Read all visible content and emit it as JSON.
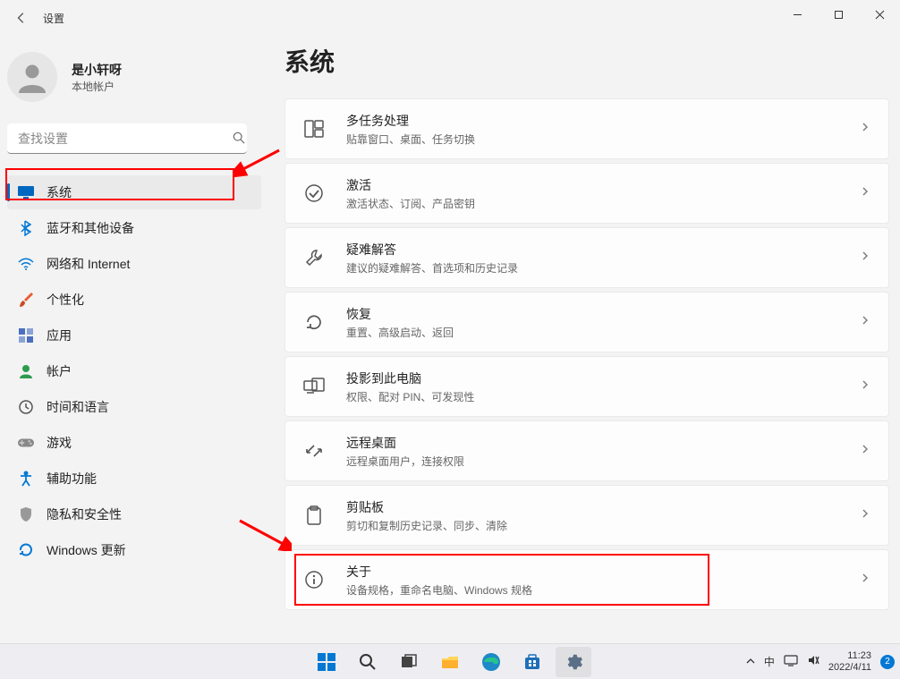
{
  "titlebar": {
    "app_name": "设置"
  },
  "user": {
    "name": "是小轩呀",
    "sub": "本地帐户"
  },
  "search": {
    "placeholder": "查找设置"
  },
  "nav": [
    {
      "label": "系统",
      "icon": "monitor",
      "color": "#0067c0",
      "selected": true
    },
    {
      "label": "蓝牙和其他设备",
      "icon": "bluetooth",
      "color": "#0078d4"
    },
    {
      "label": "网络和 Internet",
      "icon": "wifi",
      "color": "#0078d4"
    },
    {
      "label": "个性化",
      "icon": "brush",
      "color": "#e85c33"
    },
    {
      "label": "应用",
      "icon": "apps",
      "color": "#4a6fbf"
    },
    {
      "label": "帐户",
      "icon": "person",
      "color": "#2e9b4f"
    },
    {
      "label": "时间和语言",
      "icon": "clock",
      "color": "#555"
    },
    {
      "label": "游戏",
      "icon": "game",
      "color": "#777"
    },
    {
      "label": "辅助功能",
      "icon": "accessibility",
      "color": "#0078d4"
    },
    {
      "label": "隐私和安全性",
      "icon": "shield",
      "color": "#888"
    },
    {
      "label": "Windows 更新",
      "icon": "update",
      "color": "#0078d4"
    }
  ],
  "page": {
    "title": "系统"
  },
  "cards": [
    {
      "title": "多任务处理",
      "sub": "贴靠窗口、桌面、任务切换",
      "icon": "multitask"
    },
    {
      "title": "激活",
      "sub": "激活状态、订阅、产品密钥",
      "icon": "check"
    },
    {
      "title": "疑难解答",
      "sub": "建议的疑难解答、首选项和历史记录",
      "icon": "wrench"
    },
    {
      "title": "恢复",
      "sub": "重置、高级启动、返回",
      "icon": "recovery"
    },
    {
      "title": "投影到此电脑",
      "sub": "权限、配对 PIN、可发现性",
      "icon": "project"
    },
    {
      "title": "远程桌面",
      "sub": "远程桌面用户，连接权限",
      "icon": "remote"
    },
    {
      "title": "剪贴板",
      "sub": "剪切和复制历史记录、同步、清除",
      "icon": "clipboard"
    },
    {
      "title": "关于",
      "sub": "设备规格，重命名电脑、Windows 规格",
      "icon": "info"
    }
  ],
  "taskbar": {
    "ime": "中",
    "time": "11:23",
    "date": "2022/4/11",
    "notif_count": "2"
  }
}
